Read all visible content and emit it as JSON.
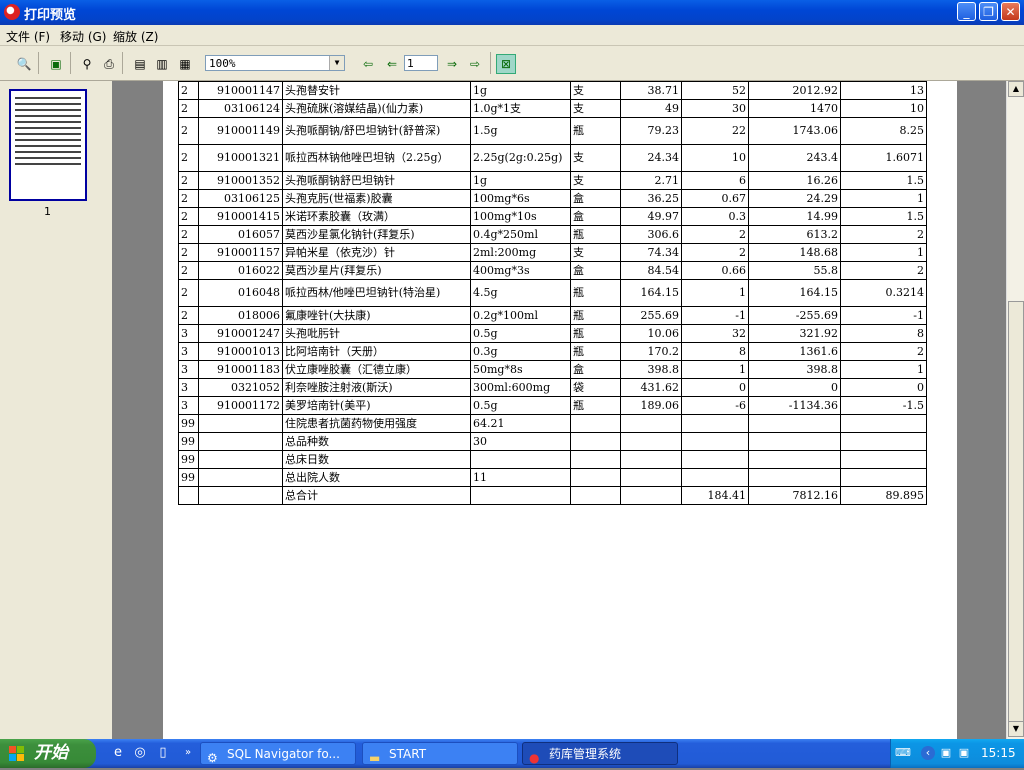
{
  "window": {
    "title": "打印预览"
  },
  "menu": [
    "文件 (F)",
    "移动 (G)",
    "缩放 (Z)"
  ],
  "toolbar": {
    "zoom_value": "100%",
    "page_value": "1"
  },
  "thumbnail": {
    "page_label": "1"
  },
  "report": {
    "rows": [
      [
        "2",
        "910001147",
        "头孢替安针",
        "1g",
        "支",
        "38.71",
        "52",
        "2012.92",
        "13"
      ],
      [
        "2",
        "03106124",
        "头孢硫脒(溶媒结晶)(仙力素)",
        "1.0g*1支",
        "支",
        "49",
        "30",
        "1470",
        "10"
      ],
      [
        "2",
        "910001149",
        "头孢哌酮钠/舒巴坦钠针(舒普深)",
        "1.5g",
        "瓶",
        "79.23",
        "22",
        "1743.06",
        "8.25"
      ],
      [
        "2",
        "910001321",
        "哌拉西林钠他唑巴坦钠（2.25g）",
        "2.25g(2g:0.25g)",
        "支",
        "24.34",
        "10",
        "243.4",
        "1.6071"
      ],
      [
        "2",
        "910001352",
        "头孢哌酮钠舒巴坦钠针",
        "1g",
        "支",
        "2.71",
        "6",
        "16.26",
        "1.5"
      ],
      [
        "2",
        "03106125",
        "头孢克肟(世福素)胶囊",
        "100mg*6s",
        "盒",
        "36.25",
        "0.67",
        "24.29",
        "1"
      ],
      [
        "2",
        "910001415",
        "米诺环素胶囊（玫满）",
        "100mg*10s",
        "盒",
        "49.97",
        "0.3",
        "14.99",
        "1.5"
      ],
      [
        "2",
        "016057",
        "莫西沙星氯化钠针(拜复乐)",
        "0.4g*250ml",
        "瓶",
        "306.6",
        "2",
        "613.2",
        "2"
      ],
      [
        "2",
        "910001157",
        "异帕米星（依克沙）针",
        "2ml:200mg",
        "支",
        "74.34",
        "2",
        "148.68",
        "1"
      ],
      [
        "2",
        "016022",
        "莫西沙星片(拜复乐)",
        "400mg*3s",
        "盒",
        "84.54",
        "0.66",
        "55.8",
        "2"
      ],
      [
        "2",
        "016048",
        "哌拉西林/他唑巴坦钠针(特治星)",
        "4.5g",
        "瓶",
        "164.15",
        "1",
        "164.15",
        "0.3214"
      ],
      [
        "2",
        "018006",
        "氟康唑针(大扶康)",
        "0.2g*100ml",
        "瓶",
        "255.69",
        "-1",
        "-255.69",
        "-1"
      ],
      [
        "3",
        "910001247",
        "头孢吡肟针",
        "0.5g",
        "瓶",
        "10.06",
        "32",
        "321.92",
        "8"
      ],
      [
        "3",
        "910001013",
        "比阿培南针（天册）",
        "0.3g",
        "瓶",
        "170.2",
        "8",
        "1361.6",
        "2"
      ],
      [
        "3",
        "910001183",
        "伏立康唑胶囊（汇德立康）",
        "50mg*8s",
        "盒",
        "398.8",
        "1",
        "398.8",
        "1"
      ],
      [
        "3",
        "0321052",
        "利奈唑胺注射液(斯沃)",
        "300ml:600mg",
        "袋",
        "431.62",
        "0",
        "0",
        "0"
      ],
      [
        "3",
        "910001172",
        "美罗培南针(美平)",
        "0.5g",
        "瓶",
        "189.06",
        "-6",
        "-1134.36",
        "-1.5"
      ],
      [
        "99",
        "",
        "住院患者抗菌药物使用强度",
        "64.21",
        "",
        "",
        "",
        "",
        ""
      ],
      [
        "99",
        "",
        "总品种数",
        "30",
        "",
        "",
        "",
        "",
        ""
      ],
      [
        "99",
        "",
        "总床日数",
        "",
        "",
        "",
        "",
        "",
        ""
      ],
      [
        "99",
        "",
        "总出院人数",
        "11",
        "",
        "",
        "",
        "",
        ""
      ],
      [
        "",
        "",
        "总合计",
        "",
        "",
        "",
        "184.41",
        "7812.16",
        "89.895"
      ]
    ]
  },
  "taskbar": {
    "start_label": "开始",
    "tasks": [
      "SQL Navigator fo...",
      "START",
      "药库管理系统"
    ],
    "clock": "15:15"
  }
}
